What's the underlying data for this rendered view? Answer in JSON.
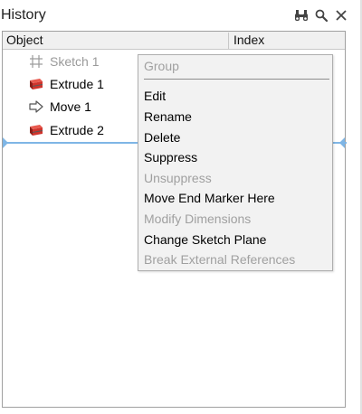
{
  "panel": {
    "title": "History",
    "icons": [
      "binoculars-icon",
      "magnifier-icon",
      "close-icon"
    ]
  },
  "columns": {
    "object": "Object",
    "index": "Index"
  },
  "tree": {
    "rows": [
      {
        "label": "Sketch 1",
        "icon": "sketch-grid-icon",
        "state": "suppressed"
      },
      {
        "label": "Extrude 1",
        "icon": "extrude-icon",
        "state": "active"
      },
      {
        "label": "Move 1",
        "icon": "move-arrow-icon",
        "state": "active"
      },
      {
        "label": "Extrude 2",
        "icon": "extrude-icon",
        "state": "active"
      }
    ],
    "end_marker_color": "#7fb6e6"
  },
  "context_menu": {
    "items": [
      {
        "label": "Group",
        "enabled": false
      },
      {
        "label": "Edit",
        "enabled": true
      },
      {
        "label": "Rename",
        "enabled": true
      },
      {
        "label": "Delete",
        "enabled": true
      },
      {
        "label": "Suppress",
        "enabled": true
      },
      {
        "label": "Unsuppress",
        "enabled": false
      },
      {
        "label": "Move End Marker Here",
        "enabled": true
      },
      {
        "label": "Modify Dimensions",
        "enabled": false
      },
      {
        "label": "Change Sketch Plane",
        "enabled": true
      },
      {
        "label": "Break External References",
        "enabled": false
      }
    ]
  },
  "colors": {
    "extrude_red": "#d0342c",
    "disabled_text": "#a0a0a0",
    "menu_background": "#f2f2f2"
  }
}
